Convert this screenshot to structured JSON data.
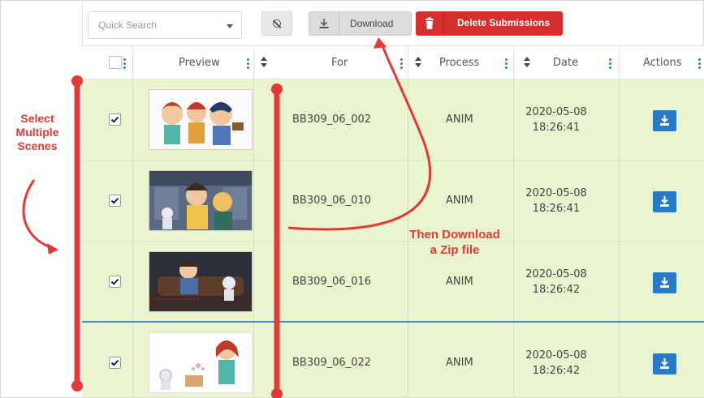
{
  "toolbar": {
    "search_placeholder": "Quick Search",
    "download_label": "Download",
    "delete_label": "Delete Submissions"
  },
  "table": {
    "headers": {
      "preview": "Preview",
      "for": "For",
      "process": "Process",
      "date": "Date",
      "actions": "Actions"
    },
    "rows": [
      {
        "for": "BB309_06_002",
        "process": "ANIM",
        "date": "2020-05-08",
        "time": "18:26:41",
        "checked": true
      },
      {
        "for": "BB309_06_010",
        "process": "ANIM",
        "date": "2020-05-08",
        "time": "18:26:41",
        "checked": true
      },
      {
        "for": "BB309_06_016",
        "process": "ANIM",
        "date": "2020-05-08",
        "time": "18:26:42",
        "checked": true
      },
      {
        "for": "BB309_06_022",
        "process": "ANIM",
        "date": "2020-05-08",
        "time": "18:26:42",
        "checked": true
      }
    ]
  },
  "annotations": {
    "select": [
      "Select",
      "Multiple",
      "Scenes"
    ],
    "then": [
      "Then Download",
      "a Zip file"
    ]
  },
  "colors": {
    "row_selected": "#eaf5cf",
    "accent_blue": "#2979c9",
    "danger": "#d62d2d",
    "annotation": "#e53935"
  }
}
